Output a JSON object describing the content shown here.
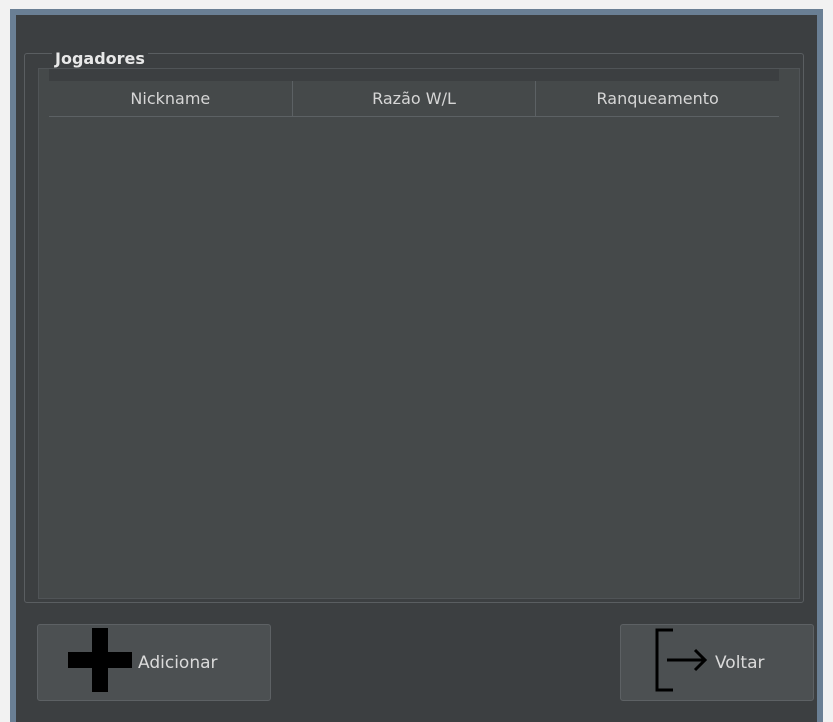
{
  "group": {
    "title": "Jogadores"
  },
  "table": {
    "columns": [
      "Nickname",
      "Razão W/L",
      "Ranqueamento"
    ],
    "rows": []
  },
  "buttons": {
    "add": {
      "label": "Adicionar",
      "icon": "plus-icon"
    },
    "back": {
      "label": "Voltar",
      "icon": "exit-arrow-icon"
    }
  }
}
